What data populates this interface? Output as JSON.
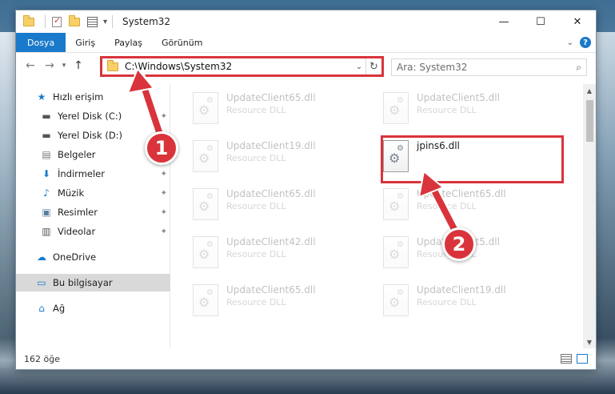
{
  "window": {
    "title": "System32",
    "controls": {
      "minimize": "—",
      "maximize": "☐",
      "close": "✕"
    }
  },
  "ribbon": {
    "tabs": [
      "Dosya",
      "Giriş",
      "Paylaş",
      "Görünüm"
    ]
  },
  "address": {
    "path": "C:\\Windows\\System32",
    "search_placeholder": "Ara: System32"
  },
  "sidebar": {
    "items": [
      {
        "label": "Hızlı erişim",
        "icon": "star-icon"
      },
      {
        "label": "Yerel Disk (C:)",
        "icon": "drive-icon"
      },
      {
        "label": "Yerel Disk (D:)",
        "icon": "drive-icon"
      },
      {
        "label": "Belgeler",
        "icon": "documents-icon"
      },
      {
        "label": "İndirmeler",
        "icon": "download-icon"
      },
      {
        "label": "Müzik",
        "icon": "music-icon"
      },
      {
        "label": "Resimler",
        "icon": "pictures-icon"
      },
      {
        "label": "Videolar",
        "icon": "video-icon"
      },
      {
        "label": "OneDrive",
        "icon": "cloud-icon"
      },
      {
        "label": "Bu bilgisayar",
        "icon": "computer-icon"
      },
      {
        "label": "Ağ",
        "icon": "network-icon"
      }
    ]
  },
  "files": [
    {
      "name": "UpdateClient65.dll",
      "type": "Resource DLL"
    },
    {
      "name": "UpdateClient5.dll",
      "type": "Resource DLL"
    },
    {
      "name": "UpdateClient19.dll",
      "type": "Resource DLL"
    },
    {
      "name": "jpins6.dll",
      "type": ""
    },
    {
      "name": "UpdateClient65.dll",
      "type": "Resource DLL"
    },
    {
      "name": "UpdateClient65.dll",
      "type": "Resource DLL"
    },
    {
      "name": "UpdateClient42.dll",
      "type": "Resource DLL"
    },
    {
      "name": "UpdateClient5.dll",
      "type": "Resource DLL"
    },
    {
      "name": "UpdateClient65.dll",
      "type": "Resource DLL"
    },
    {
      "name": "UpdateClient19.dll",
      "type": "Resource DLL"
    }
  ],
  "status": {
    "count": "162 öğe"
  },
  "annotations": {
    "step1": "1",
    "step2": "2"
  },
  "colors": {
    "accent": "#1979ca",
    "highlight": "#d9343b"
  }
}
